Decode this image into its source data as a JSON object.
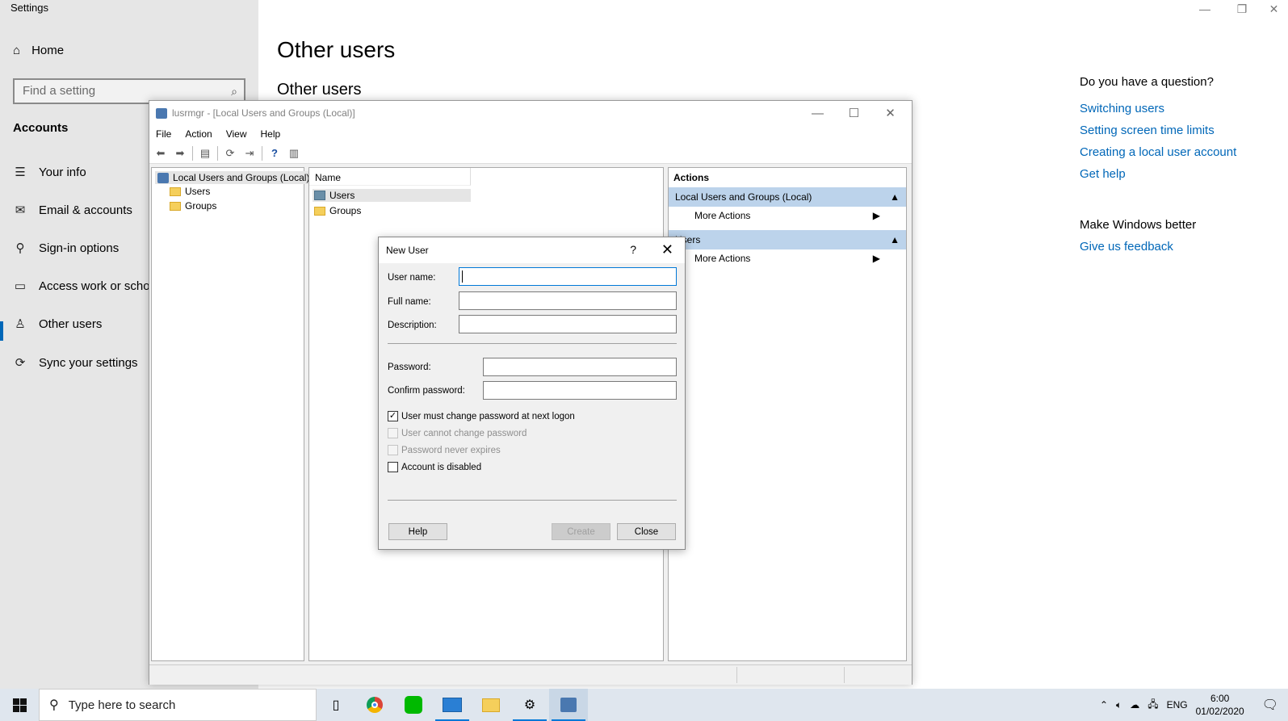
{
  "settings": {
    "window_title": "Settings",
    "home": "Home",
    "search_placeholder": "Find a setting",
    "section": "Accounts",
    "nav": [
      {
        "label": "Your info",
        "icon": "person-card-icon"
      },
      {
        "label": "Email & accounts",
        "icon": "mail-icon"
      },
      {
        "label": "Sign-in options",
        "icon": "key-icon"
      },
      {
        "label": "Access work or school",
        "icon": "briefcase-icon"
      },
      {
        "label": "Other users",
        "icon": "person-add-icon"
      },
      {
        "label": "Sync your settings",
        "icon": "sync-icon"
      }
    ],
    "page_title": "Other users",
    "section_title": "Other users",
    "help": {
      "question": "Do you have a question?",
      "links": [
        "Switching users",
        "Setting screen time limits",
        "Creating a local user account",
        "Get help"
      ],
      "better": "Make Windows better",
      "feedback": "Give us feedback"
    }
  },
  "mmc": {
    "title": "lusrmgr - [Local Users and Groups (Local)]",
    "menu": [
      "File",
      "Action",
      "View",
      "Help"
    ],
    "tree": {
      "root": "Local Users and Groups (Local)",
      "children": [
        "Users",
        "Groups"
      ]
    },
    "list": {
      "column": "Name",
      "items": [
        "Users",
        "Groups"
      ]
    },
    "actions": {
      "header": "Actions",
      "group1": "Local Users and Groups (Local)",
      "group1_item": "More Actions",
      "group2": "Users",
      "group2_item": "More Actions"
    }
  },
  "dialog": {
    "title": "New User",
    "help_glyph": "?",
    "fields": {
      "username_label": "User name:",
      "username_value": "",
      "fullname_label": "Full name:",
      "fullname_value": "",
      "description_label": "Description:",
      "description_value": "",
      "password_label": "Password:",
      "confirm_label": "Confirm password:"
    },
    "checkboxes": [
      {
        "label": "User must change password at next logon",
        "checked": true,
        "enabled": true
      },
      {
        "label": "User cannot change password",
        "checked": false,
        "enabled": false
      },
      {
        "label": "Password never expires",
        "checked": false,
        "enabled": false
      },
      {
        "label": "Account is disabled",
        "checked": false,
        "enabled": true
      }
    ],
    "buttons": {
      "help": "Help",
      "create": "Create",
      "close": "Close"
    }
  },
  "taskbar": {
    "search_placeholder": "Type here to search",
    "language": "ENG",
    "time": "6:00",
    "date": "01/02/2020"
  },
  "colors": {
    "accent": "#0067b8",
    "action_group_bg": "#bcd3eb"
  }
}
